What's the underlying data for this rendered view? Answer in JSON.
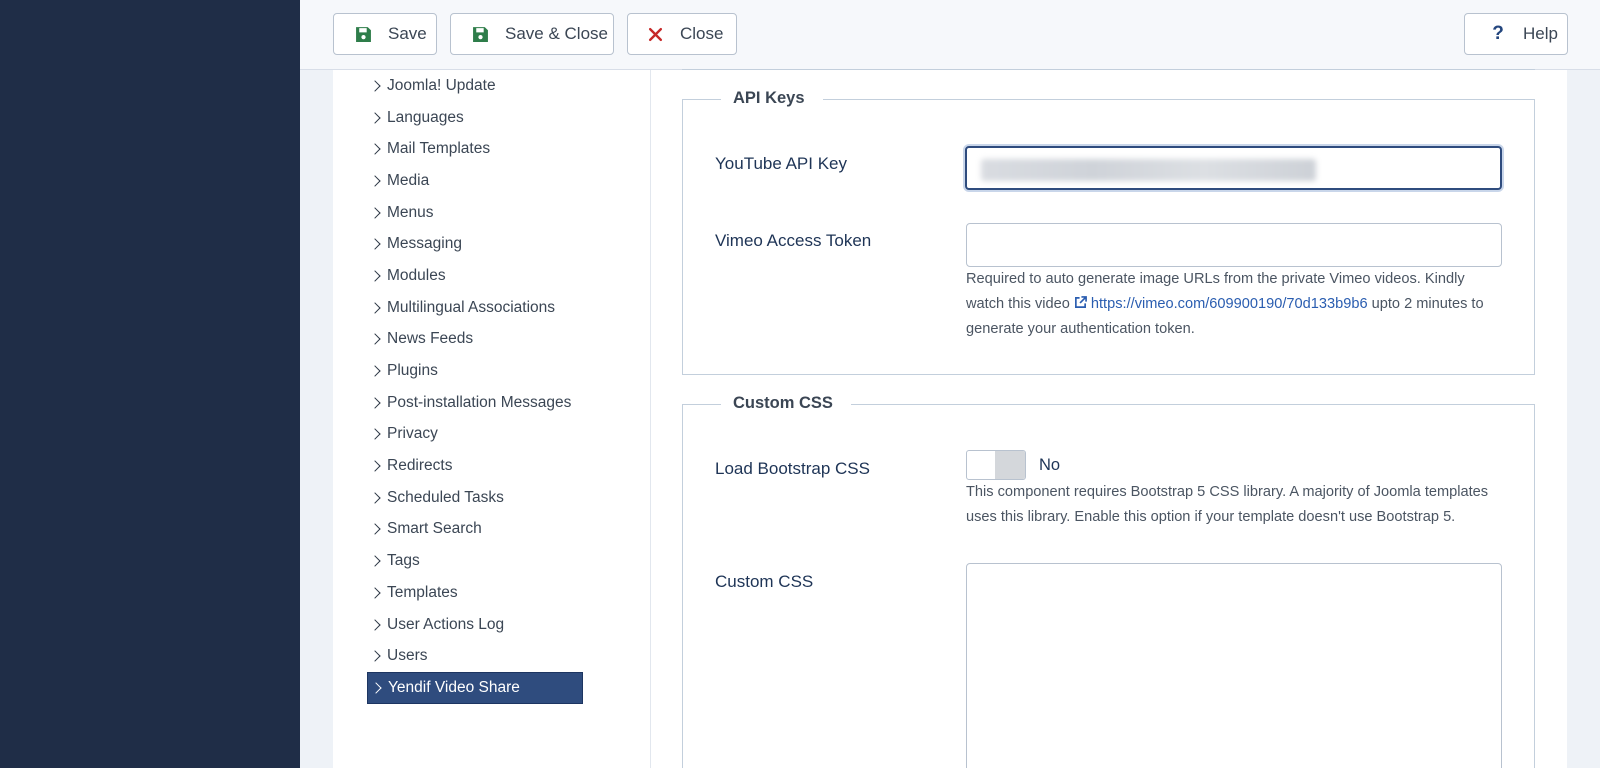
{
  "toolbar": {
    "save_label": "Save",
    "save_close_label": "Save & Close",
    "close_label": "Close",
    "help_label": "Help"
  },
  "sidebar": {
    "items": [
      {
        "label": "Joomla! Update"
      },
      {
        "label": "Languages"
      },
      {
        "label": "Mail Templates"
      },
      {
        "label": "Media"
      },
      {
        "label": "Menus"
      },
      {
        "label": "Messaging"
      },
      {
        "label": "Modules"
      },
      {
        "label": "Multilingual Associations"
      },
      {
        "label": "News Feeds"
      },
      {
        "label": "Plugins"
      },
      {
        "label": "Post-installation Messages"
      },
      {
        "label": "Privacy"
      },
      {
        "label": "Redirects"
      },
      {
        "label": "Scheduled Tasks"
      },
      {
        "label": "Smart Search"
      },
      {
        "label": "Tags"
      },
      {
        "label": "Templates"
      },
      {
        "label": "User Actions Log"
      },
      {
        "label": "Users"
      },
      {
        "label": "Yendif Video Share",
        "active": true
      }
    ]
  },
  "api_keys": {
    "legend": "API Keys",
    "youtube_label": "YouTube API Key",
    "vimeo_label": "Vimeo Access Token",
    "vimeo_help_1": "Required to auto generate image URLs from the private Vimeo videos. Kindly watch this video ",
    "vimeo_link": "https://vimeo.com/609900190/70d133b9b6",
    "vimeo_help_2": " upto 2 minutes to generate your authentication token."
  },
  "custom_css": {
    "legend": "Custom CSS",
    "bootstrap_label": "Load Bootstrap CSS",
    "bootstrap_value": "No",
    "bootstrap_help": "This component requires Bootstrap 5 CSS library. A majority of Joomla templates uses this library. Enable this option if your template doesn't use Bootstrap 5.",
    "css_label": "Custom CSS"
  },
  "colors": {
    "sidebar_dark": "#1f2d47",
    "active_item": "#2f4c7e",
    "link": "#2a5db0",
    "save_icon": "#2e7d4a",
    "close_icon": "#c62828"
  }
}
